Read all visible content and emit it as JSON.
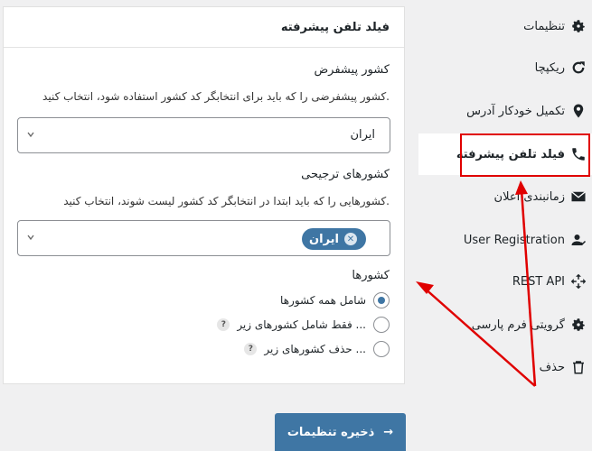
{
  "panel": {
    "title": "فیلد تلفن پیشرفته",
    "default_country": {
      "label": "کشور پیشفرض",
      "description": "کشور پیشفرضی را که باید برای انتخابگر کد کشور استفاده شود، انتخاب کنید.",
      "value": "ایران"
    },
    "preferred_countries": {
      "label": "کشورهای ترجیحی",
      "description": "کشورهایی را که باید ابتدا در انتخابگر کد کشور لیست شوند، انتخاب کنید.",
      "chip": "ایران"
    },
    "countries": {
      "label": "کشورها",
      "options": [
        {
          "label": "شامل همه کشورها",
          "checked": true
        },
        {
          "label": "فقط شامل کشورهای زیر ...",
          "checked": false,
          "help": "?"
        },
        {
          "label": "حذف کشورهای زیر ...",
          "checked": false,
          "help": "?"
        }
      ]
    }
  },
  "sidebar": {
    "items": [
      {
        "label": "تنظیمات",
        "icon": "gear-icon"
      },
      {
        "label": "ریکپچا",
        "icon": "recaptcha-icon"
      },
      {
        "label": "تکمیل خودکار آدرس",
        "icon": "location-pin-icon"
      },
      {
        "label": "فیلد تلفن پیشرفته",
        "icon": "phone-icon",
        "active": true
      },
      {
        "label": "زمانبندی اعلان",
        "icon": "envelope-icon"
      },
      {
        "label": "User Registration",
        "icon": "user-icon"
      },
      {
        "label": "REST API",
        "icon": "api-icon"
      },
      {
        "label": "گرویتی فرم پارسی",
        "icon": "gear-icon"
      },
      {
        "label": "حذف",
        "icon": "trash-icon"
      }
    ]
  },
  "save_button": {
    "label": "ذخیره تنظیمات",
    "arrow": "→"
  },
  "colors": {
    "accent": "#3f76a4",
    "annotation": "#e00000"
  }
}
